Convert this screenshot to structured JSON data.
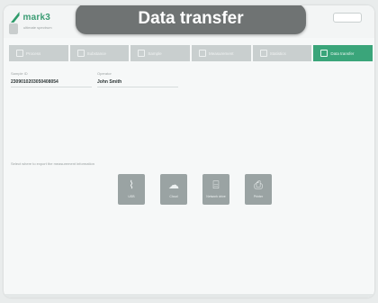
{
  "app": {
    "logo_text": "mark3",
    "logo_sub": "ultimate spectrum",
    "title": "Data transfer"
  },
  "topbar": {
    "right_items": [
      "",
      ""
    ]
  },
  "steps": [
    {
      "label": "Process"
    },
    {
      "label": "Substance"
    },
    {
      "label": "Sample"
    },
    {
      "label": "Measurement"
    },
    {
      "label": "Statistics"
    },
    {
      "label": "Data transfer"
    }
  ],
  "fields": {
    "sample_id_label": "Sample ID",
    "sample_id_value": "2309010203050408054",
    "operator_label": "Operator",
    "operator_value": "John Smith"
  },
  "section": {
    "label": "Select where to export the measurement information"
  },
  "actions": [
    {
      "name": "usb",
      "label": "USB",
      "icon": "usb-icon"
    },
    {
      "name": "cloud",
      "label": "Cloud",
      "icon": "cloud-icon"
    },
    {
      "name": "network",
      "label": "Network drive",
      "icon": "network-icon"
    },
    {
      "name": "printer",
      "label": "Printer",
      "icon": "printer-icon"
    }
  ],
  "colors": {
    "accent": "#3aa57a",
    "inactive_step": "#c9cfcf",
    "title_pill": "#6f7373",
    "action_tile": "#9aa3a3"
  }
}
